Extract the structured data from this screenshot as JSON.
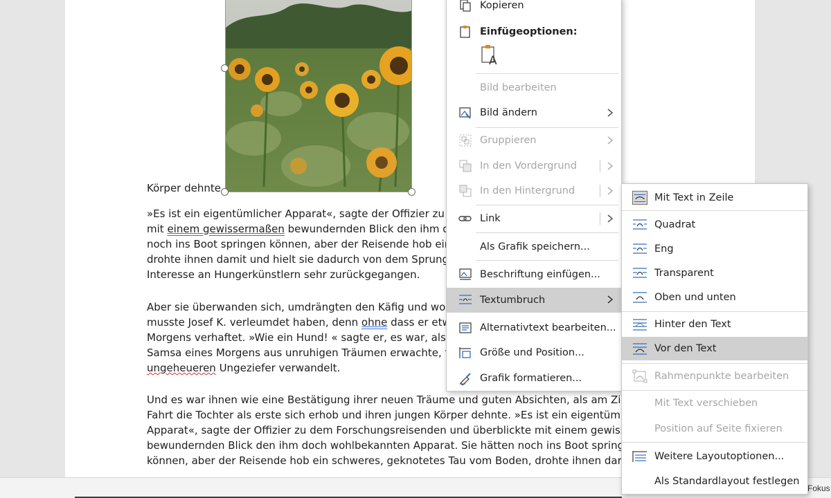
{
  "document": {
    "caption_fragment": "Körper dehnte",
    "p1": {
      "l1": "»Es ist ein eigentümlicher Apparat«, sagte der Offizier zu d",
      "l2a": "mit ",
      "l2u": "einem gewissermaßen",
      "l2b": " bewundernden Blick den ihm d",
      "l3": "noch ins Boot springen können, aber der Reisende hob ein",
      "l4": "drohte ihnen damit und hielt sie dadurch von dem Sprung",
      "l5": "Interesse an Hungerkünstlern sehr zurückgegangen."
    },
    "p2": {
      "l1": "Aber sie überwanden sich, umdrängten den Käfig und wol",
      "l2a": "musste Josef K. verleumdet haben, denn ",
      "l2u": "ohne",
      "l2b": " dass er etw",
      "l3": "Morgens verhaftet. »Wie ein Hund! « sagte er, es war, als",
      "l4": "Samsa eines Morgens aus unruhigen Träumen erwachte, f",
      "l5u": "ungeheueren",
      "l5b": " Ungeziefer verwandelt."
    },
    "p3": {
      "l1": "Und es war ihnen wie eine Bestätigung ihrer neuen Träume und guten Absichten, als am Zie",
      "l2": "Fahrt die Tochter als erste sich erhob und ihren jungen Körper dehnte. »Es ist ein eigentüml",
      "l3": "Apparat«, sagte der Offizier zu dem Forschungsreisenden und überblickte mit einem gewiss",
      "l4": "bewundernden Blick den ihm doch wohlbekannten Apparat. Sie hätten noch ins Boot spring",
      "l5": "können, aber der Reisende hob ein schweres, geknotetes Tau vom Boden, drohte ihnen dar"
    }
  },
  "status_bar": {
    "focus_label": "Fokus"
  },
  "context_menu": {
    "copy": "Kopieren",
    "paste_options": "Einfügeoptionen:",
    "edit_image": "Bild bearbeiten",
    "change_image": "Bild ändern",
    "group": "Gruppieren",
    "bring_forward": "In den Vordergrund",
    "send_backward": "In den Hintergrund",
    "link": "Link",
    "save_as_picture": "Als Grafik speichern...",
    "insert_caption": "Beschriftung einfügen...",
    "wrap_text": "Textumbruch",
    "alt_text": "Alternativtext bearbeiten...",
    "size_position": "Größe und Position...",
    "format_picture": "Grafik formatieren..."
  },
  "wrap_submenu": {
    "inline": "Mit Text in Zeile",
    "square": "Quadrat",
    "tight": "Eng",
    "through": "Transparent",
    "top_bottom": "Oben und unten",
    "behind_text": "Hinter den Text",
    "in_front_text": "Vor den Text",
    "edit_wrap_points": "Rahmenpunkte bearbeiten",
    "move_with_text": "Mit Text verschieben",
    "fix_position": "Position auf Seite fixieren",
    "more_layout": "Weitere Layoutoptionen...",
    "set_default": "Als Standardlayout festlegen"
  },
  "colors": {
    "icon_blue": "#2f6fc4",
    "highlight": "#d0d0d0",
    "disabled_text": "#a6a6a6"
  }
}
